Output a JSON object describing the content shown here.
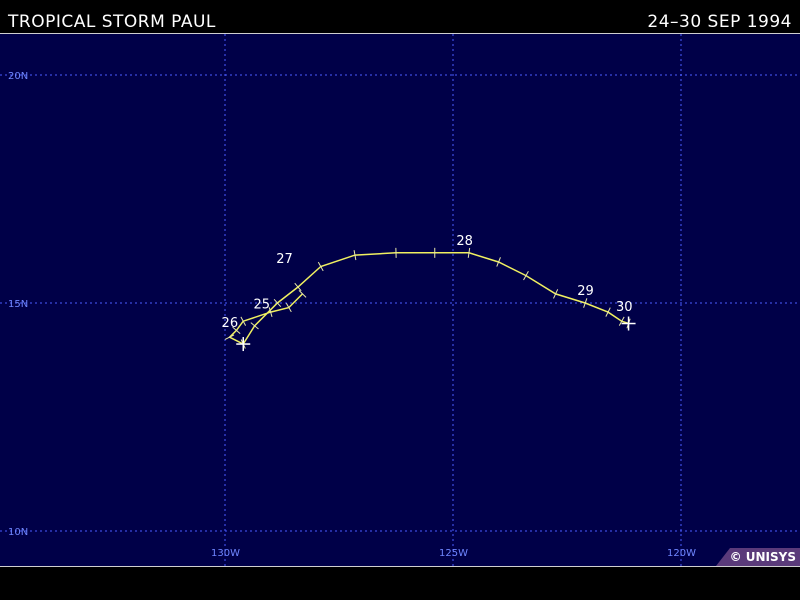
{
  "header": {
    "title": "TROPICAL STORM PAUL",
    "dates": "24–30 SEP 1994"
  },
  "map": {
    "background_color": "#000048",
    "grid_color": "#4a5cff",
    "track_color": "#f0f060",
    "lat_labels": [
      {
        "lat": 20,
        "text": "20N"
      },
      {
        "lat": 15,
        "text": "15N"
      },
      {
        "lat": 10,
        "text": "10N"
      }
    ],
    "lon_labels": [
      {
        "lon": -130,
        "text": "130W"
      },
      {
        "lon": -125,
        "text": "125W"
      },
      {
        "lon": -120,
        "text": "120W"
      }
    ],
    "track": [
      {
        "lon": -128.3,
        "lat": 15.2
      },
      {
        "lon": -128.6,
        "lat": 14.9
      },
      {
        "lon": -129.0,
        "lat": 14.8
      },
      {
        "lon": -129.6,
        "lat": 14.6
      },
      {
        "lon": -129.75,
        "lat": 14.4
      },
      {
        "lon": -129.9,
        "lat": 14.25
      },
      {
        "lon": -129.6,
        "lat": 14.1
      },
      {
        "lon": -129.35,
        "lat": 14.5
      },
      {
        "lon": -128.85,
        "lat": 15.0
      },
      {
        "lon": -128.4,
        "lat": 15.35
      },
      {
        "lon": -127.9,
        "lat": 15.8
      },
      {
        "lon": -127.15,
        "lat": 16.05
      },
      {
        "lon": -126.25,
        "lat": 16.1
      },
      {
        "lon": -125.4,
        "lat": 16.1
      },
      {
        "lon": -124.65,
        "lat": 16.1
      },
      {
        "lon": -124.0,
        "lat": 15.9
      },
      {
        "lon": -123.4,
        "lat": 15.6
      },
      {
        "lon": -122.75,
        "lat": 15.2
      },
      {
        "lon": -122.1,
        "lat": 15.0
      },
      {
        "lon": -121.6,
        "lat": 14.8
      },
      {
        "lon": -121.3,
        "lat": 14.6
      },
      {
        "lon": -121.15,
        "lat": 14.55
      }
    ],
    "date_labels": [
      {
        "text": "25",
        "lon": -129.2,
        "lat": 14.7
      },
      {
        "text": "26",
        "lon": -129.9,
        "lat": 14.3
      },
      {
        "text": "27",
        "lon": -128.7,
        "lat": 15.7
      },
      {
        "text": "28",
        "lon": -124.75,
        "lat": 16.1
      },
      {
        "text": "29",
        "lon": -122.1,
        "lat": 15.0
      },
      {
        "text": "30",
        "lon": -121.25,
        "lat": 14.65
      }
    ]
  },
  "credit": "© UNISYS"
}
